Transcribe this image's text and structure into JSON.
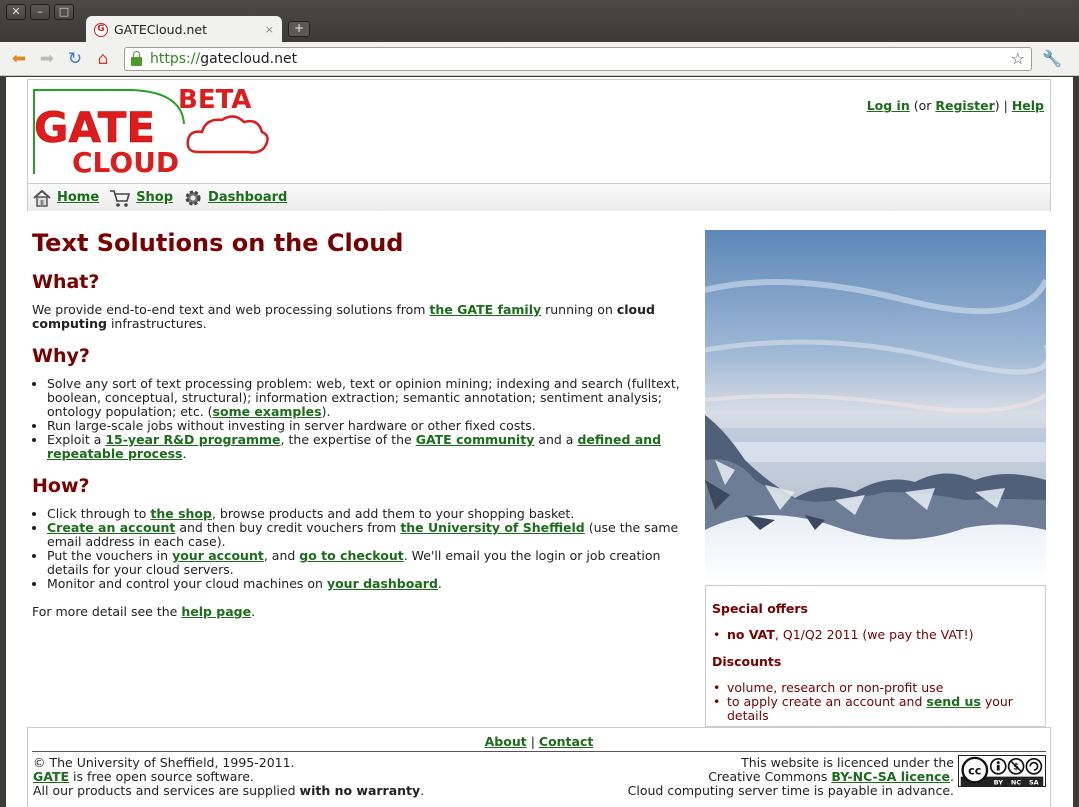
{
  "browser": {
    "tab_title": "GATECloud.net",
    "tab_close": "×",
    "new_tab": "+",
    "window_buttons": [
      "✕",
      "–",
      "□"
    ],
    "url_scheme": "https://",
    "url_host": "gatecloud.net"
  },
  "header": {
    "logo": {
      "beta": "BETA",
      "gate": "GATE",
      "cloud": "CLOUD"
    },
    "login": "Log in",
    "or_open": " (or ",
    "register": "Register",
    "or_close": ") | ",
    "help": "Help"
  },
  "menu": [
    {
      "label": "Home",
      "icon": "house-icon"
    },
    {
      "label": "Shop",
      "icon": "cart-icon"
    },
    {
      "label": "Dashboard",
      "icon": "gear-icon"
    }
  ],
  "content": {
    "title": "Text Solutions on the Cloud",
    "what": {
      "heading": "What?",
      "t1": "We provide end-to-end text and web processing solutions from ",
      "link1": "the GATE family",
      "t2": " running on ",
      "bold": "cloud computing",
      "t3": " infrastructures."
    },
    "why": {
      "heading": "Why?",
      "b1_text": "Solve any sort of text processing problem: web, text or opinion mining; indexing and search (fulltext, boolean, conceptual, structural); information extraction; semantic annotation; sentiment analysis; ontology population; etc. (",
      "b1_link": "some examples",
      "b1_end": ").",
      "b2_text": "Run large-scale jobs without investing in server hardware or other fixed costs.",
      "b3_t1": "Exploit a ",
      "b3_link1": "15-year R&D programme",
      "b3_t2": ", the expertise of the ",
      "b3_link2": "GATE community",
      "b3_t3": " and a ",
      "b3_link3": "defined and repeatable process",
      "b3_end": "."
    },
    "how": {
      "heading": "How?",
      "b1_t1": "Click through to ",
      "b1_link": "the shop",
      "b1_t2": ", browse products and add them to your shopping basket.",
      "b2_link1": "Create an account",
      "b2_t1": " and then buy credit vouchers from ",
      "b2_link2": "the University of Sheffield",
      "b2_t2": " (use the same email address in each case).",
      "b3_t1": "Put the vouchers in ",
      "b3_link1": "your account",
      "b3_t2": ", and ",
      "b3_link2": "go to checkout",
      "b3_t3": ". We'll email you the login or job creation details for your cloud servers.",
      "b4_t1": "Monitor and control your cloud machines on ",
      "b4_link": "your dashboard",
      "b4_end": "."
    },
    "more_t1": "For more detail see the ",
    "more_link": "help page",
    "more_end": "."
  },
  "sidebar": {
    "offers_heading": "Special offers",
    "offer_bold": "no VAT",
    "offer_text": ", Q1/Q2 2011 (we pay the VAT!)",
    "discounts_heading": "Discounts",
    "discount1": "volume, research or non-profit use",
    "discount2_t1": "to apply create an account and ",
    "discount2_link": "send us",
    "discount2_t2": " your details"
  },
  "footer": {
    "about": "About",
    "sep": " | ",
    "contact": "Contact",
    "copyright": "© The University of Sheffield, 1995-2011.",
    "gate_link": "GATE",
    "gate_text": " is free open source software.",
    "warranty_t1": "All our products and services are supplied ",
    "warranty_bold": "with no warranty",
    "warranty_end": ".",
    "licence_l1": "This website is licenced under the",
    "licence_l2_t1": "Creative Commons ",
    "licence_link": "BY-NC-SA licence",
    "licence_l2_end": ".",
    "licence_l3": "Cloud computing server time is payable in advance.",
    "cc_badge": {
      "cc": "cc",
      "by": "BY",
      "nc": "NC",
      "sa": "SA"
    }
  },
  "colors": {
    "heading": "#7a0000",
    "link": "#1a6e1a",
    "logo_red": "#e01b1b",
    "logo_green": "#22a322"
  }
}
